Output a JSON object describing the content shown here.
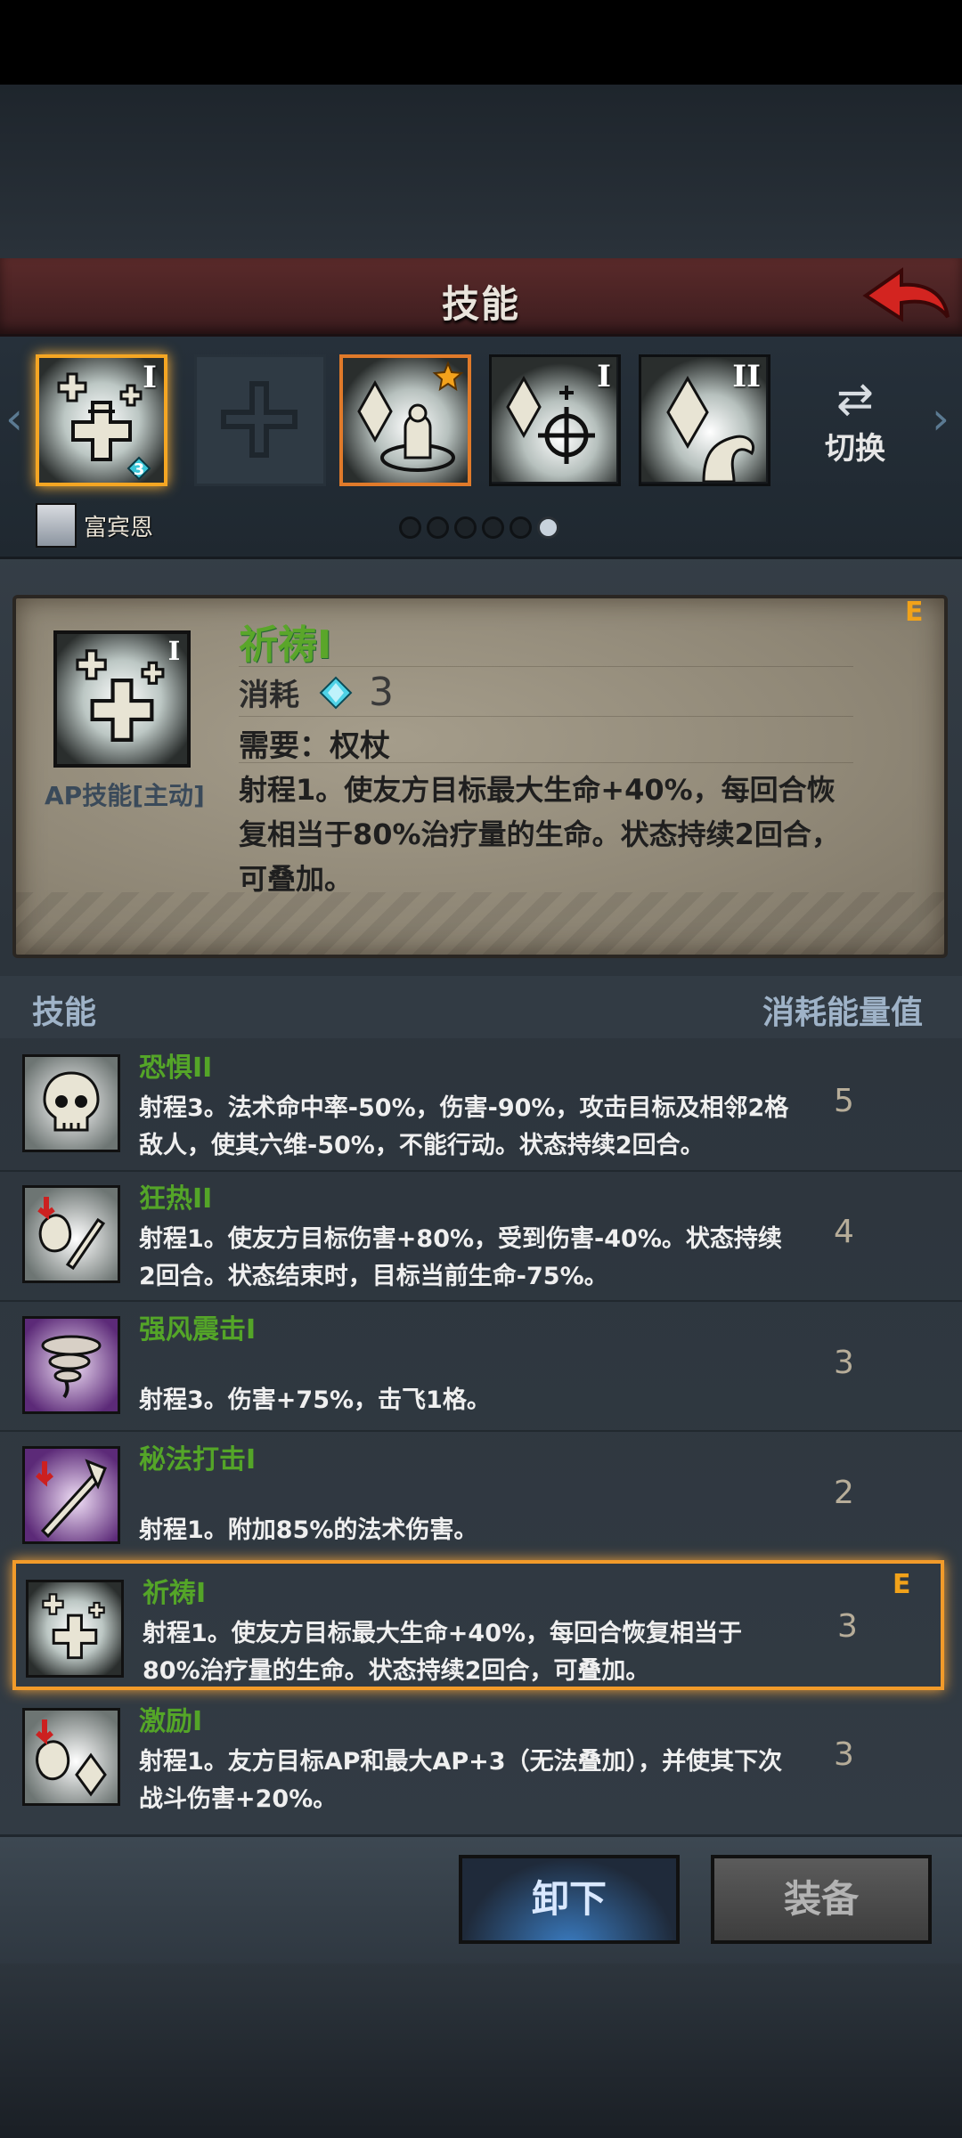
{
  "header": {
    "title": "技能",
    "back_icon": "back-arrow-icon"
  },
  "strip": {
    "slots": [
      {
        "icon": "heal-cross-icon",
        "roman": "I",
        "badge": "3",
        "state": "active"
      },
      {
        "icon": "empty-slot-cross-icon",
        "roman": "",
        "state": "empty"
      },
      {
        "icon": "crystal-priest-icon",
        "roman": "",
        "state": "highlighted",
        "star": true
      },
      {
        "icon": "crystal-target-icon",
        "roman": "I",
        "state": "normal"
      },
      {
        "icon": "crystal-hand-icon",
        "roman": "II",
        "state": "normal"
      }
    ],
    "switch_label": "切换",
    "character_name": "富宾恩",
    "page_dots": 6,
    "active_dot": 5
  },
  "detail": {
    "name": "祈祷I",
    "e_tag": "E",
    "cost_label": "消耗",
    "cost_value": "3",
    "requirement": "需要：权杖",
    "type_tag": "AP技能[主动]",
    "description": "射程1。使友方目标最大生命+40%，每回合恢复相当于80%治疗量的生命。状态持续2回合，可叠加。",
    "icon_roman": "I"
  },
  "list": {
    "header_left": "技能",
    "header_right": "消耗能量值",
    "items": [
      {
        "name": "恐惧II",
        "desc": "射程3。法术命中率-50%，伤害-90%，攻击目标及相邻2格敌人，使其六维-50%，不能行动。状态持续2回合。",
        "cost": "5",
        "icon": "skull-icon"
      },
      {
        "name": "狂热II",
        "desc": "射程1。使友方目标伤害+80%，受到伤害-40%。状态持续2回合。状态结束时，目标当前生命-75%。",
        "cost": "4",
        "icon": "frenzy-sword-icon"
      },
      {
        "name": "强风震击I",
        "desc": "射程3。伤害+75%，击飞1格。",
        "cost": "3",
        "icon": "tornado-icon"
      },
      {
        "name": "秘法打击I",
        "desc": "射程1。附加85%的法术伤害。",
        "cost": "2",
        "icon": "arcane-strike-icon"
      },
      {
        "name": "祈祷I",
        "desc": "射程1。使友方目标最大生命+40%，每回合恢复相当于80%治疗量的生命。状态持续2回合，可叠加。",
        "cost": "3",
        "icon": "heal-cross-icon",
        "e_tag": "E",
        "selected": true
      },
      {
        "name": "激励I",
        "desc": "射程1。友方目标AP和最大AP+3（无法叠加），并使其下次战斗伤害+20%。",
        "cost": "3",
        "icon": "inspire-icon"
      }
    ]
  },
  "buttons": {
    "unequip": "卸下",
    "equip": "装备"
  },
  "colors": {
    "skill_name_green": "#54a528",
    "accent_orange": "#f29b2a",
    "title_bar_red": "#5a2a2a"
  }
}
